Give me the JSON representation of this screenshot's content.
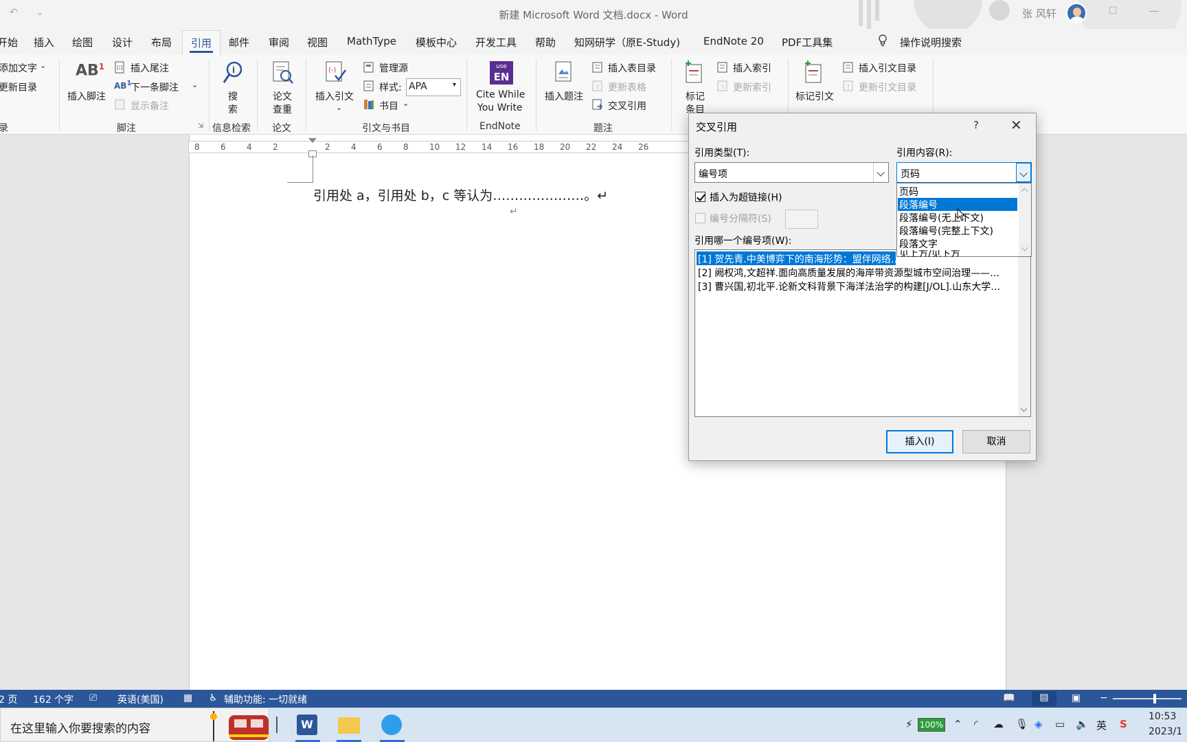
{
  "titlebar": {
    "title": "新建 Microsoft Word 文档.docx  -  Word",
    "user": "张 风轩"
  },
  "tabs": [
    {
      "label": "开始"
    },
    {
      "label": "插入"
    },
    {
      "label": "绘图"
    },
    {
      "label": "设计"
    },
    {
      "label": "布局"
    },
    {
      "label": "引用"
    },
    {
      "label": "邮件"
    },
    {
      "label": "审阅"
    },
    {
      "label": "视图"
    },
    {
      "label": "MathType"
    },
    {
      "label": "模板中心"
    },
    {
      "label": "开发工具"
    },
    {
      "label": "帮助"
    },
    {
      "label": "知网研学（原E-Study)"
    },
    {
      "label": "EndNote 20"
    },
    {
      "label": "PDF工具集"
    }
  ],
  "help_search": "操作说明搜索",
  "ribbon": {
    "toc": {
      "add_text": "添加文字",
      "update": "更新目录",
      "group": "录"
    },
    "footnotes": {
      "insert_footnote": "插入脚注",
      "insert_endnote": "插入尾注",
      "next_footnote": "下一条脚注",
      "show_notes": "显示备注",
      "group": "脚注"
    },
    "research": {
      "search_l1": "搜",
      "search_l2": "索",
      "group": "信息检索"
    },
    "paper": {
      "check_l1": "论文",
      "check_l2": "查重",
      "group": "论文"
    },
    "citations": {
      "insert_citation": "插入引文",
      "manage_sources": "管理源",
      "style_label": "样式:",
      "style_value": "APA",
      "bibliography": "书目",
      "group": "引文与书目"
    },
    "endnote": {
      "cwyw_l1": "Cite While",
      "cwyw_l2": "You Write",
      "group": "EndNote"
    },
    "captions": {
      "insert_caption": "插入题注",
      "insert_tof": "插入表目录",
      "update_table": "更新表格",
      "cross_ref": "交叉引用",
      "group": "题注"
    },
    "index": {
      "mark_l1": "标记",
      "mark_l2": "条目",
      "insert_index": "插入索引",
      "update_index": "更新索引"
    },
    "toa": {
      "mark_citation": "标记引文",
      "insert_toa": "插入引文目录",
      "update_toa": "更新引文目录"
    }
  },
  "ruler": [
    "8",
    "6",
    "4",
    "2",
    "2",
    "4",
    "6",
    "8",
    "10",
    "12",
    "14",
    "16",
    "18",
    "20",
    "22",
    "24",
    "26"
  ],
  "document": {
    "line": "引用处 a，引用处 b，c 等认为…………………。↵",
    "para_mark": "↵"
  },
  "dialog": {
    "title": "交叉引用",
    "help": "?",
    "ref_type_label": "引用类型(T):",
    "ref_type_value": "编号项",
    "ref_content_label": "引用内容(R):",
    "ref_content_value": "页码",
    "hyperlink_label": "插入为超链接(H)",
    "separator_label": "编号分隔符(S)",
    "which_label": "引用哪一个编号项(W):",
    "items": [
      "[1] 贺先青.中美博弈下的南海形势：盟伴网络…",
      "[2] 阙权鸿,文超祥.面向高质量发展的海岸带资源型城市空间治理——…",
      "[3] 曹兴国,初北平.论新文科背景下海洋法治学的构建[J/OL].山东大学…"
    ],
    "dropdown_options": [
      "页码",
      "段落编号",
      "段落编号(无上下文)",
      "段落编号(完整上下文)",
      "段落文字",
      "见上方/见下方"
    ],
    "insert_button": "插入(I)",
    "cancel_button": "取消"
  },
  "statusbar": {
    "page": "2 页",
    "words": "162 个字",
    "language": "英语(美国)",
    "accessibility": "辅助功能: 一切就绪"
  },
  "taskbar": {
    "search_placeholder": "在这里输入你要搜索的内容",
    "battery": "100%",
    "ime": "英",
    "time": "10:53",
    "date": "2023/1"
  },
  "colors": {
    "accent": "#2b579a",
    "selection": "#0078d7",
    "taskbar": "#d7e5f3"
  }
}
